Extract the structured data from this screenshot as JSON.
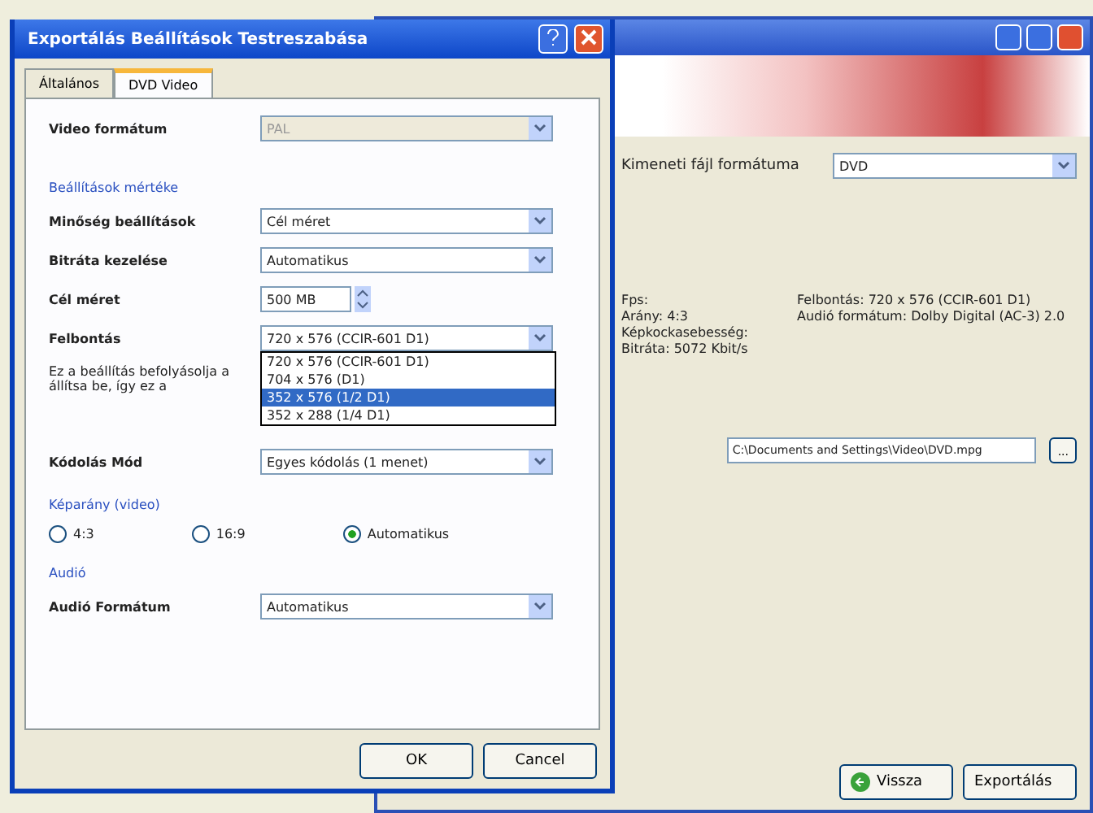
{
  "main_window": {
    "format_label": "Kimeneti fájl formátuma",
    "format_value": "DVD",
    "info_left": [
      "Fps:",
      "Arány: 4:3",
      "Képkockasebesség:",
      "Bitráta: 5072 Kbit/s"
    ],
    "info_right": [
      "Felbontás: 720 x 576 (CCIR-601 D1)",
      "Audió formátum: Dolby Digital (AC-3) 2.0"
    ],
    "path": "C:\\Documents and Settings\\Video\\DVD.mpg",
    "browse": "...",
    "buttons": [
      {
        "label": "Vissza",
        "kind": "back"
      },
      {
        "label": "Exportálás",
        "kind": "export"
      }
    ]
  },
  "dialog": {
    "title": "Exportálás Beállítások Testreszabása",
    "tabs": [
      {
        "label": "Általános",
        "selected": false
      },
      {
        "label": "DVD Video",
        "selected": true
      }
    ],
    "video_format": {
      "label": "Video formátum",
      "value": "PAL",
      "disabled": true
    },
    "quality_group": "Beállítások mértéke",
    "rows": [
      {
        "label": "Minőség beállítások",
        "value": "Cél méret",
        "kind": "select"
      },
      {
        "label": "Bitráta kezelése",
        "value": "Automatikus",
        "kind": "select"
      },
      {
        "label": "Cél méret",
        "value": "500 MB",
        "kind": "spin"
      },
      {
        "label": "Felbontás",
        "value": "720 x 576 (CCIR-601 D1)",
        "kind": "select"
      }
    ],
    "note": "Ez a beállítás befolyásolja a\nállítsa be, így ez a",
    "resolution_options": [
      {
        "label": "720 x 576 (CCIR-601 D1)",
        "selected": false
      },
      {
        "label": "704 x 576 (D1)",
        "selected": false
      },
      {
        "label": "352 x 576 (1/2 D1)",
        "selected": true
      },
      {
        "label": "352 x 288 (1/4 D1)",
        "selected": false
      }
    ],
    "encoding": {
      "label": "Kódolás Mód",
      "value": "Egyes kódolás (1 menet)"
    },
    "aspect_group": "Képarány (video)",
    "aspect": [
      {
        "label": "4:3",
        "selected": false
      },
      {
        "label": "16:9",
        "selected": false
      },
      {
        "label": "Automatikus",
        "selected": true
      }
    ],
    "audio_group": "Audió",
    "audio": {
      "label": "Audió Formátum",
      "value": "Automatikus"
    },
    "buttons": [
      "OK",
      "Cancel"
    ]
  }
}
